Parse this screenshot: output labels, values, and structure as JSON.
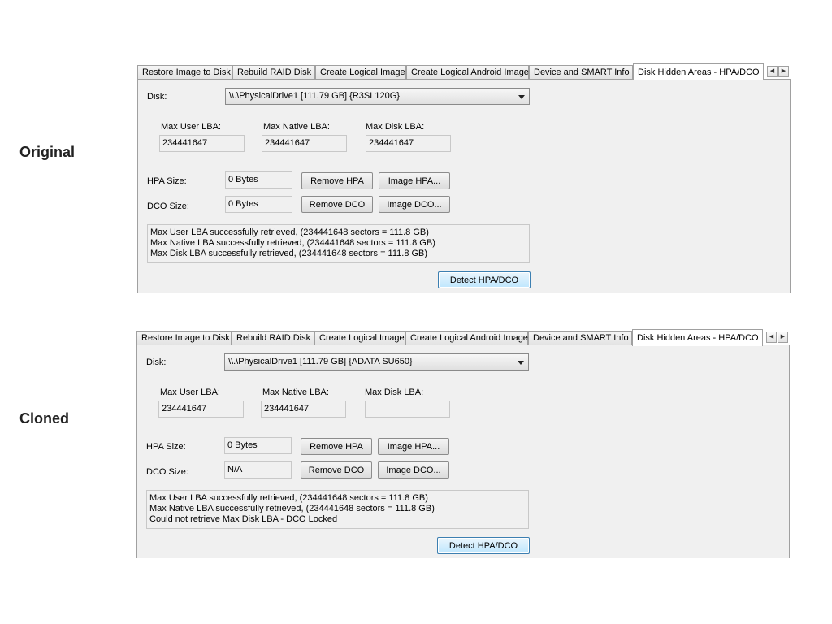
{
  "labels": {
    "original": "Original",
    "cloned": "Cloned"
  },
  "tabs": [
    "Restore Image to Disk",
    "Rebuild RAID Disk",
    "Create Logical Image",
    "Create Logical Android Image",
    "Device and SMART Info",
    "Disk Hidden Areas - HPA/DCO"
  ],
  "common": {
    "disk_label": "Disk:",
    "max_user_lba_label": "Max User LBA:",
    "max_native_lba_label": "Max Native LBA:",
    "max_disk_lba_label": "Max Disk LBA:",
    "hpa_size_label": "HPA Size:",
    "dco_size_label": "DCO Size:",
    "remove_hpa": "Remove HPA",
    "image_hpa": "Image HPA...",
    "remove_dco": "Remove DCO",
    "image_dco": "Image DCO...",
    "detect": "Detect HPA/DCO"
  },
  "original": {
    "disk_value": "\\\\.\\PhysicalDrive1 [111.79 GB] {R3SL120G}",
    "max_user_lba": "234441647",
    "max_native_lba": "234441647",
    "max_disk_lba": "234441647",
    "hpa_size": "0 Bytes",
    "dco_size": "0 Bytes",
    "log": [
      "Max User LBA successfully retrieved, (234441648 sectors = 111.8 GB)",
      "Max Native LBA successfully retrieved, (234441648 sectors = 111.8 GB)",
      "Max Disk LBA successfully retrieved, (234441648 sectors = 111.8 GB)"
    ]
  },
  "cloned": {
    "disk_value": "\\\\.\\PhysicalDrive1 [111.79 GB] {ADATA SU650}",
    "max_user_lba": "234441647",
    "max_native_lba": "234441647",
    "max_disk_lba": "",
    "hpa_size": "0 Bytes",
    "dco_size": "N/A",
    "log": [
      "Max User LBA successfully retrieved, (234441648 sectors = 111.8 GB)",
      "Max Native LBA successfully retrieved, (234441648 sectors = 111.8 GB)",
      "Could not retrieve Max Disk LBA - DCO Locked"
    ]
  }
}
